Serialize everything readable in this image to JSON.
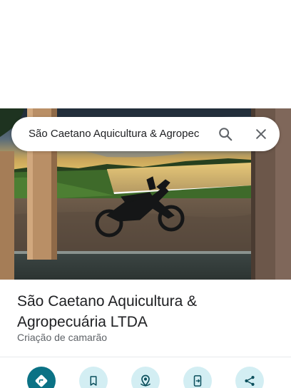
{
  "search": {
    "query": "São Caetano Aquicultura & Agropec"
  },
  "place": {
    "title": "São Caetano Aquicultura & Agropecuária LTDA",
    "category": "Criação de camarão"
  },
  "actions": [
    {
      "icon": "directions-icon"
    },
    {
      "icon": "bookmark-icon"
    },
    {
      "icon": "nearby-icon"
    },
    {
      "icon": "send-to-phone-icon"
    },
    {
      "icon": "share-icon"
    }
  ],
  "colors": {
    "primary_action": "#0b7285",
    "secondary_action": "#d3eef3",
    "text_primary": "#202124",
    "text_secondary": "#5f6368"
  }
}
